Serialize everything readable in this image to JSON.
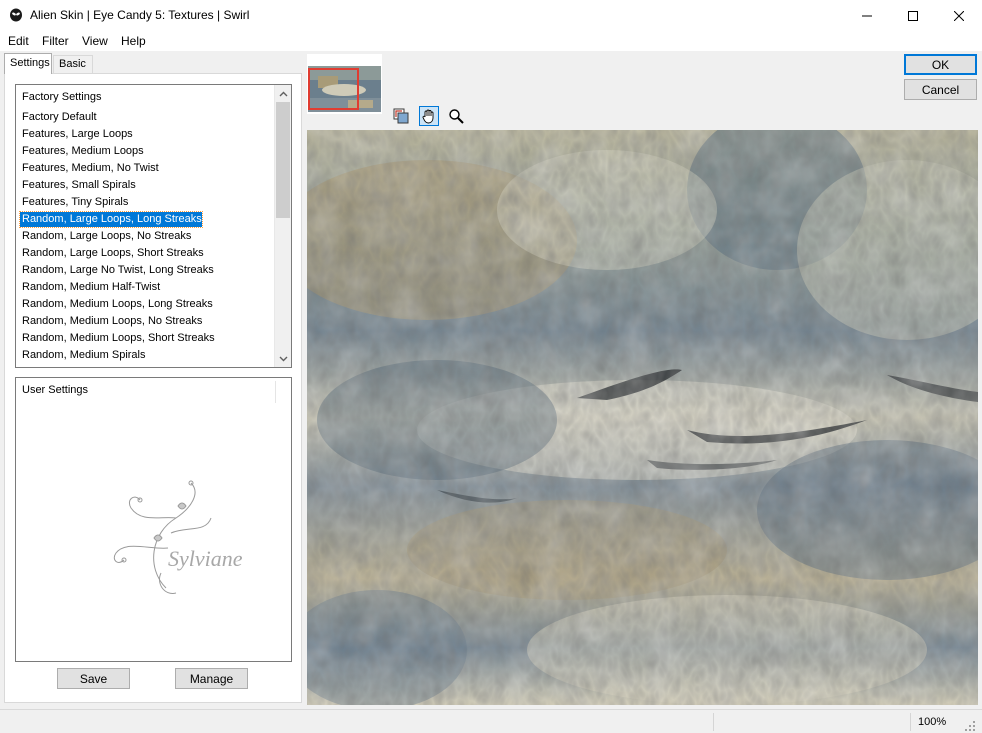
{
  "window": {
    "title": "Alien Skin | Eye Candy 5: Textures | Swirl"
  },
  "menu": [
    "Edit",
    "Filter",
    "View",
    "Help"
  ],
  "tabs": [
    "Settings",
    "Basic"
  ],
  "factory_settings": {
    "header": "Factory Settings",
    "selected_index": 6,
    "items": [
      "Factory Default",
      "Features, Large Loops",
      "Features, Medium Loops",
      "Features, Medium, No Twist",
      "Features, Small Spirals",
      "Features, Tiny Spirals",
      "Random, Large Loops, Long Streaks",
      "Random, Large Loops, No Streaks",
      "Random, Large Loops, Short Streaks",
      "Random, Large No Twist, Long Streaks",
      "Random, Medium Half-Twist",
      "Random, Medium Loops, Long Streaks",
      "Random, Medium Loops, No Streaks",
      "Random, Medium Loops, Short Streaks",
      "Random, Medium Spirals"
    ]
  },
  "user_settings": {
    "header": "User Settings",
    "watermark_text": "Sylviane"
  },
  "buttons": {
    "save": "Save",
    "manage": "Manage",
    "ok": "OK",
    "cancel": "Cancel"
  },
  "tools": [
    "compare-icon",
    "hand-icon",
    "zoom-icon"
  ],
  "status": {
    "zoom": "100%"
  },
  "colors": {
    "selection": "#0078d7",
    "preview_blue": "#5f7386",
    "preview_tan": "#b3a27a",
    "preview_cream": "#d8d4c0"
  }
}
